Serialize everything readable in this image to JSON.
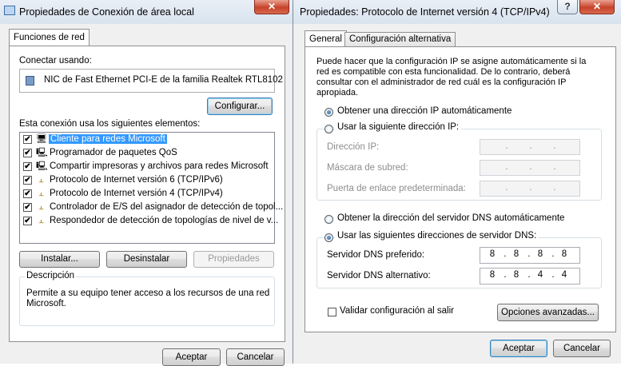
{
  "left_window": {
    "title": "Propiedades de Conexión de área local",
    "close_glyph": "✕",
    "tab": "Funciones de red",
    "connect_using_label": "Conectar usando:",
    "adapter_name": "NIC de Fast Ethernet PCI-E de la familia Realtek RTL8102",
    "configure_button": "Configurar...",
    "components_label": "Esta conexión usa los siguientes elementos:",
    "components": [
      {
        "label": "Cliente para redes Microsoft",
        "icon": "client-icon",
        "glyph": "🖥",
        "checked": true,
        "selected": true
      },
      {
        "label": "Programador de paquetes QoS",
        "icon": "service-icon",
        "glyph": "🖳",
        "checked": true,
        "selected": false
      },
      {
        "label": "Compartir impresoras y archivos para redes Microsoft",
        "icon": "service-icon",
        "glyph": "🖳",
        "checked": true,
        "selected": false
      },
      {
        "label": "Protocolo de Internet versión 6 (TCP/IPv6)",
        "icon": "protocol-icon",
        "glyph": "⫠",
        "checked": true,
        "selected": false
      },
      {
        "label": "Protocolo de Internet versión 4 (TCP/IPv4)",
        "icon": "protocol-icon",
        "glyph": "⫠",
        "checked": true,
        "selected": false
      },
      {
        "label": "Controlador de E/S del asignador de detección de topol...",
        "icon": "protocol-icon",
        "glyph": "⫠",
        "checked": true,
        "selected": false
      },
      {
        "label": "Respondedor de detección de topologías de nivel de v...",
        "icon": "protocol-icon",
        "glyph": "⫠",
        "checked": true,
        "selected": false
      }
    ],
    "install_button": "Instalar...",
    "uninstall_button": "Desinstalar",
    "properties_button": "Propiedades",
    "description_title": "Descripción",
    "description_text_line1": "Permite a su equipo tener acceso a los recursos de una red",
    "description_text_line2": "Microsoft.",
    "ok_button": "Aceptar",
    "cancel_button": "Cancelar"
  },
  "right_window": {
    "title": "Propiedades: Protocolo de Internet versión 4 (TCP/IPv4)",
    "help_glyph": "?",
    "close_glyph": "✕",
    "tabs": [
      "General",
      "Configuración alternativa"
    ],
    "info_line1": "Puede hacer que la configuración IP se asigne automáticamente si la",
    "info_line2": "red es compatible con esta funcionalidad. De lo contrario, deberá",
    "info_line3": "consultar con el administrador de red cuál es la configuración IP",
    "info_line4": "apropiada.",
    "ip_auto_radio": "Obtener una dirección IP automáticamente",
    "ip_manual_radio": "Usar la siguiente dirección IP:",
    "ip_address_label": "Dirección IP:",
    "subnet_label": "Máscara de subred:",
    "gateway_label": "Puerta de enlace predeterminada:",
    "dns_auto_radio": "Obtener la dirección del servidor DNS automáticamente",
    "dns_manual_radio": "Usar las siguientes direcciones de servidor DNS:",
    "preferred_dns_label": "Servidor DNS preferido:",
    "preferred_dns": [
      "8",
      "8",
      "8",
      "8"
    ],
    "alternate_dns_label": "Servidor DNS alternativo:",
    "alternate_dns": [
      "8",
      "8",
      "4",
      "4"
    ],
    "ip_dot": ".",
    "validate_checkbox": "Validar configuración al salir",
    "advanced_button": "Opciones avanzadas...",
    "ok_button": "Aceptar",
    "cancel_button": "Cancelar",
    "ip_auto_selected": true,
    "dns_manual_selected": true,
    "validate_checked": false
  },
  "colors": {
    "selection": "#3399ff",
    "focus_border": "#3c7fb1"
  }
}
